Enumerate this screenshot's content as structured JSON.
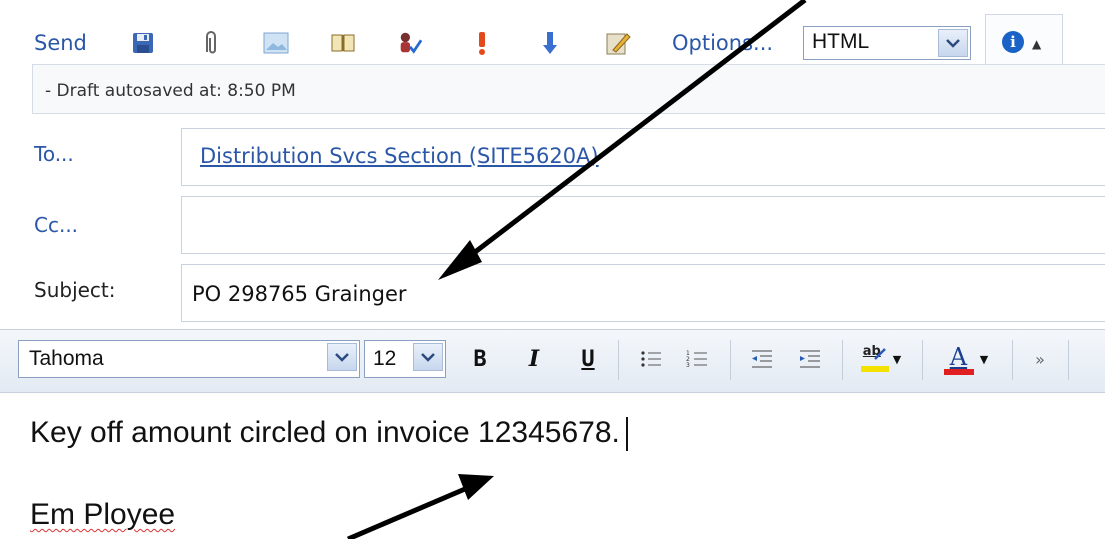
{
  "toolbar": {
    "send_label": "Send",
    "options_label": "Options...",
    "format_value": "HTML",
    "icons": [
      "save-icon",
      "attach-icon",
      "insert-image-icon",
      "address-book-icon",
      "check-names-icon",
      "high-importance-icon",
      "low-importance-icon",
      "signature-icon",
      "info-icon"
    ]
  },
  "draft_status": "- Draft autosaved at: 8:50 PM",
  "fields": {
    "to_label": "To...",
    "to_value": "Distribution Svcs Section (SITE5620A)",
    "cc_label": "Cc...",
    "cc_value": "",
    "subject_label": "Subject:",
    "subject_value": "PO 298765 Grainger"
  },
  "format_bar": {
    "font": "Tahoma",
    "size": "12",
    "bold": "B",
    "italic": "I",
    "underline": "U",
    "highlight_label": "ab",
    "font_color_label": "A"
  },
  "body": {
    "line1": "Key off amount circled on invoice 12345678.",
    "line2": "Em Ployee"
  },
  "colors": {
    "link": "#2a57a8",
    "highlight": "#f5e100",
    "font_color": "#e02020"
  }
}
